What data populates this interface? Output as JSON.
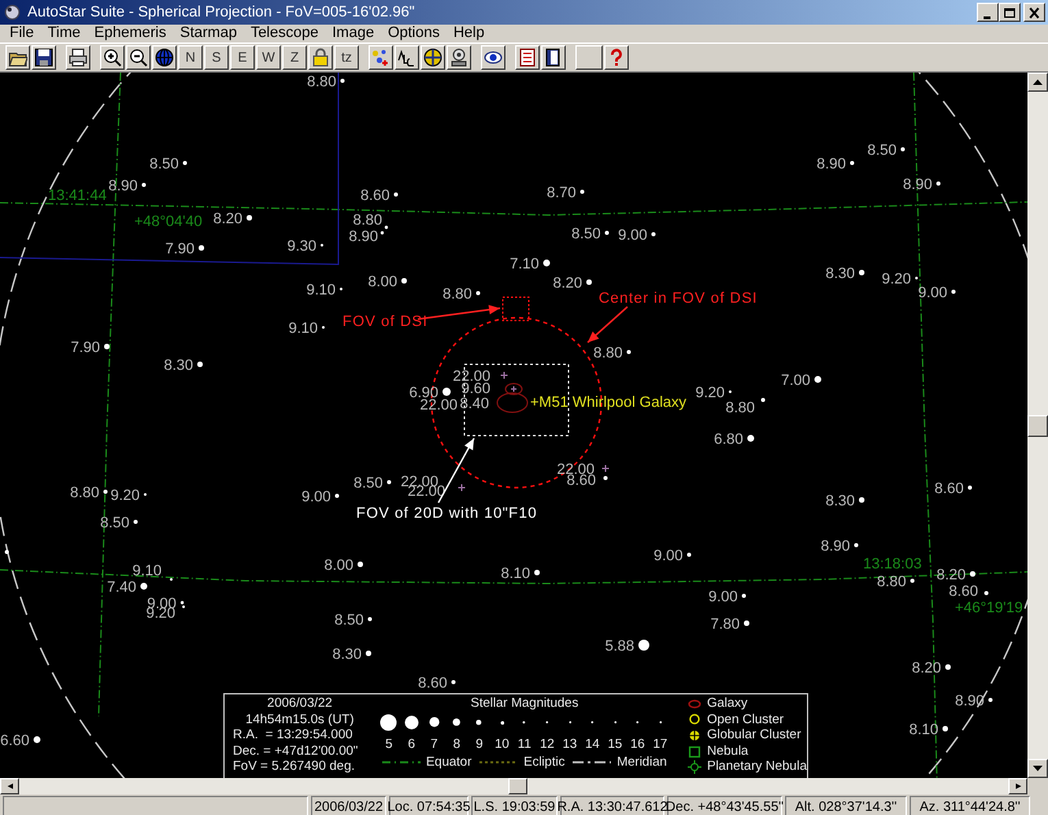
{
  "window": {
    "title": "AutoStar Suite - Spherical Projection - FoV=005-16'02.96\""
  },
  "menu": [
    "File",
    "Time",
    "Ephemeris",
    "Starmap",
    "Telescope",
    "Image",
    "Options",
    "Help"
  ],
  "toolbar": {
    "letter_buttons": [
      "N",
      "S",
      "E",
      "W",
      "Z"
    ],
    "tz_button": "tz"
  },
  "sky_map": {
    "stars": [
      {
        "label": "8.80",
        "kind": "star"
      },
      {
        "label": "8.50",
        "kind": "star"
      },
      {
        "label": "8.50",
        "kind": "star"
      },
      {
        "label": "8.90",
        "kind": "star"
      },
      {
        "label": "8.90",
        "kind": "star"
      },
      {
        "label": "8.90",
        "kind": "star"
      },
      {
        "label": "8.60",
        "kind": "star"
      },
      {
        "label": "8.70",
        "kind": "star"
      },
      {
        "label": "8.20",
        "kind": "star"
      },
      {
        "label": "8.80",
        "kind": "star"
      },
      {
        "label": "8.90",
        "kind": "star"
      },
      {
        "label": "8.50",
        "kind": "star"
      },
      {
        "label": "9.00",
        "kind": "star"
      },
      {
        "label": "7.90",
        "kind": "star"
      },
      {
        "label": "9.30",
        "kind": "star"
      },
      {
        "label": "7.10",
        "kind": "star"
      },
      {
        "label": "8.00",
        "kind": "star"
      },
      {
        "label": "8.20",
        "kind": "star"
      },
      {
        "label": "8.30",
        "kind": "star"
      },
      {
        "label": "9.20",
        "kind": "star"
      },
      {
        "label": "9.10",
        "kind": "star"
      },
      {
        "label": "8.80",
        "kind": "star"
      },
      {
        "label": "9.00",
        "kind": "star"
      },
      {
        "label": "9.10",
        "kind": "star"
      },
      {
        "label": "7.90",
        "kind": "star"
      },
      {
        "label": "8.80",
        "kind": "star"
      },
      {
        "label": "8.30",
        "kind": "star"
      },
      {
        "label": "22.00",
        "kind": "faint"
      },
      {
        "label": "7.00",
        "kind": "star"
      },
      {
        "label": "6.90",
        "kind": "star"
      },
      {
        "label": "9.60",
        "kind": "galaxy"
      },
      {
        "label": "9.20",
        "kind": "star"
      },
      {
        "label": "22.00",
        "kind": "plain"
      },
      {
        "label": "8.40",
        "kind": "galaxy"
      },
      {
        "label": "8.80",
        "kind": "star"
      },
      {
        "label": "6.80",
        "kind": "star"
      },
      {
        "label": "22.00",
        "kind": "faint"
      },
      {
        "label": "8.80",
        "kind": "star"
      },
      {
        "label": "9.20",
        "kind": "star"
      },
      {
        "label": "9.00",
        "kind": "star"
      },
      {
        "label": "8.50",
        "kind": "star"
      },
      {
        "label": "22.00",
        "kind": "plain"
      },
      {
        "label": "22.00",
        "kind": "faint"
      },
      {
        "label": "8.60",
        "kind": "star"
      },
      {
        "label": "8.30",
        "kind": "star"
      },
      {
        "label": "8.60",
        "kind": "star"
      },
      {
        "label": "8.50",
        "kind": "star"
      },
      {
        "label": "8.90",
        "kind": "star"
      },
      {
        "label": "9.00",
        "kind": "star"
      },
      {
        "label": "9.10",
        "kind": "star"
      },
      {
        "label": "8.00",
        "kind": "star"
      },
      {
        "label": "8.10",
        "kind": "star"
      },
      {
        "label": "8.20",
        "kind": "star"
      },
      {
        "label": "7.40",
        "kind": "star"
      },
      {
        "label": "9.00",
        "kind": "star"
      },
      {
        "label": "8.80",
        "kind": "star"
      },
      {
        "label": "8.60",
        "kind": "star"
      },
      {
        "label": "9.00",
        "kind": "star"
      },
      {
        "label": "9.20",
        "kind": "star"
      },
      {
        "label": "8.50",
        "kind": "star"
      },
      {
        "label": "7.80",
        "kind": "star"
      },
      {
        "label": "5.88",
        "kind": "star"
      },
      {
        "label": "8.30",
        "kind": "star"
      },
      {
        "label": "8.20",
        "kind": "star"
      },
      {
        "label": "8.60",
        "kind": "star"
      },
      {
        "label": "8.90",
        "kind": "star"
      },
      {
        "label": "8.10",
        "kind": "star"
      },
      {
        "label": "6.60",
        "kind": "star"
      }
    ],
    "grid_labels": [
      "13:41:44",
      "+48°04'40",
      "13:18:03",
      "+46°19'19"
    ],
    "annotations": [
      {
        "kind": "red",
        "text": "FOV of DSI"
      },
      {
        "kind": "red",
        "text": "Center in FOV of DSI"
      },
      {
        "kind": "white",
        "text": "FOV of 20D with 10\"F10"
      },
      {
        "kind": "object",
        "text": "+M51 Whirlpool Galaxy"
      }
    ]
  },
  "legend": {
    "info": [
      "2006/03/22",
      "14h54m15.0s (UT)",
      "R.A.  = 13:29:54.000",
      "Dec. = +47d12'00.00\"",
      "FoV = 5.267490 deg."
    ],
    "magnitudes_title": "Stellar Magnitudes",
    "magnitudes": [
      "5",
      "6",
      "7",
      "8",
      "9",
      "10",
      "11",
      "12",
      "13",
      "14",
      "15",
      "16",
      "17"
    ],
    "lines": [
      {
        "kind": "equator",
        "label": "Equator"
      },
      {
        "kind": "ecliptic",
        "label": "Ecliptic"
      },
      {
        "kind": "meridian",
        "label": "Meridian"
      }
    ],
    "objects": [
      {
        "kind": "galaxy",
        "label": "Galaxy"
      },
      {
        "kind": "open-cluster",
        "label": "Open Cluster"
      },
      {
        "kind": "globular-cluster",
        "label": "Globular Cluster"
      },
      {
        "kind": "nebula",
        "label": "Nebula"
      },
      {
        "kind": "planetary-nebula",
        "label": "Planetary Nebula"
      }
    ]
  },
  "status_bar": [
    "2006/03/22",
    "Loc. 07:54:35",
    "L.S. 19:03:59",
    "R.A. 13:30:47.612",
    "Dec. +48°43'45.55''",
    "Alt. 028°37'14.3''",
    "Az. 311°44'24.8''"
  ]
}
